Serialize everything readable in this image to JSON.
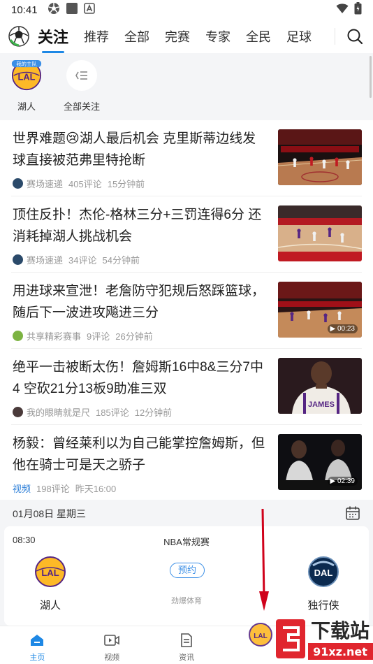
{
  "status_bar": {
    "time": "10:41"
  },
  "top_nav": {
    "tabs": [
      "关注",
      "推荐",
      "全部",
      "完赛",
      "专家",
      "全民",
      "足球"
    ]
  },
  "follow": {
    "items": [
      {
        "label": "湖人",
        "logo_text": "LAL",
        "badge": "我的主队"
      },
      {
        "label": "全部关注"
      }
    ]
  },
  "news": [
    {
      "title": "世界难题😢湖人最后机会 克里斯蒂边线发球直接被范弗里特抢断",
      "source": "赛场速递",
      "comments": "405评论",
      "time": "15分钟前"
    },
    {
      "title": "顶住反扑！杰伦-格林三分+三罚连得6分 还消耗掉湖人挑战机会",
      "source": "赛场速递",
      "comments": "34评论",
      "time": "54分钟前"
    },
    {
      "title": "用进球来宣泄！老詹防守犯规后怒踩篮球，随后下一波进攻飚进三分",
      "source": "共享精彩赛事",
      "comments": "9评论",
      "time": "26分钟前",
      "duration": "00:23"
    },
    {
      "title": "绝平一击被断太伤！詹姆斯16中8&三分7中4 空砍21分13板9助准三双",
      "source": "我的眼睛就是尺",
      "comments": "185评论",
      "time": "12分钟前",
      "jersey": "JAMES"
    },
    {
      "title": "杨毅：曾经莱利以为自己能掌控詹姆斯，但他在骑士可是天之骄子",
      "source": "视频",
      "comments": "198评论",
      "time": "昨天16:00",
      "duration": "02:39"
    }
  ],
  "schedule": {
    "date": "01月08日 星期三",
    "match": {
      "time": "08:30",
      "league": "NBA常规赛",
      "home": {
        "name": "湖人",
        "abbr": "LAL"
      },
      "away": {
        "name": "独行侠",
        "abbr": "DAL"
      },
      "reserve_label": "预约",
      "broadcaster": "劲爆体育"
    }
  },
  "bottom_nav": {
    "tabs": [
      "主页",
      "视频",
      "资讯"
    ]
  },
  "watermark": {
    "main": "下载站",
    "url": "91xz.net"
  },
  "colors": {
    "accent": "#1e88e5",
    "lakers_purple": "#552583",
    "lakers_gold": "#FDB927",
    "mavs_navy": "#0b2a4f",
    "annotation_red": "#d0021b"
  },
  "icons": {
    "search": "search-icon",
    "calendar": "calendar-icon",
    "home": "home-icon",
    "video": "video-icon",
    "news": "news-icon"
  }
}
